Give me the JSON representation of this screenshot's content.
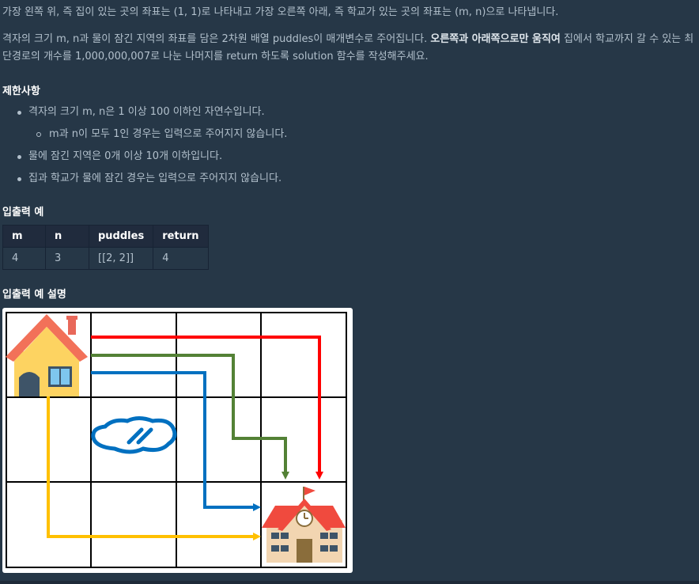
{
  "paragraphs": {
    "p1": "가장 왼쪽 위, 즉 집이 있는 곳의 좌표는 (1, 1)로 나타내고 가장 오른쪽 아래, 즉 학교가 있는 곳의 좌표는 (m, n)으로 나타냅니다.",
    "p2_a": "격자의 크기 m, n과 물이 잠긴 지역의 좌표를 담은 2차원 배열 puddles이 매개변수로 주어집니다. ",
    "p2_bold": "오른쪽과 아래쪽으로만 움직여",
    "p2_b": " 집에서 학교까지 갈 수 있는 최",
    "p3": "단경로의 개수를 1,000,000,007로 나눈 나머지를 return 하도록 solution 함수를 작성해주세요."
  },
  "constraints": {
    "heading": "제한사항",
    "items": [
      "격자의 크기 m, n은 1 이상 100 이하인 자연수입니다.",
      "m과 n이 모두 1인 경우는 입력으로 주어지지 않습니다.",
      "물에 잠긴 지역은 0개 이상 10개 이하입니다.",
      "집과 학교가 물에 잠긴 경우는 입력으로 주어지지 않습니다."
    ]
  },
  "examples": {
    "heading": "입출력 예",
    "columns": [
      "m",
      "n",
      "puddles",
      "return"
    ],
    "rows": [
      [
        "4",
        "3",
        "[[2, 2]]",
        "4"
      ]
    ]
  },
  "explanation": {
    "heading": "입출력 예 설명"
  },
  "figure": {
    "grid_cols": 4,
    "grid_rows": 3,
    "path_colors": [
      "#ff0000",
      "#538135",
      "#0070c0",
      "#ffc000"
    ],
    "puddle_color": "#0070c0",
    "icons": [
      "house-icon",
      "puddle-icon",
      "school-icon"
    ]
  }
}
